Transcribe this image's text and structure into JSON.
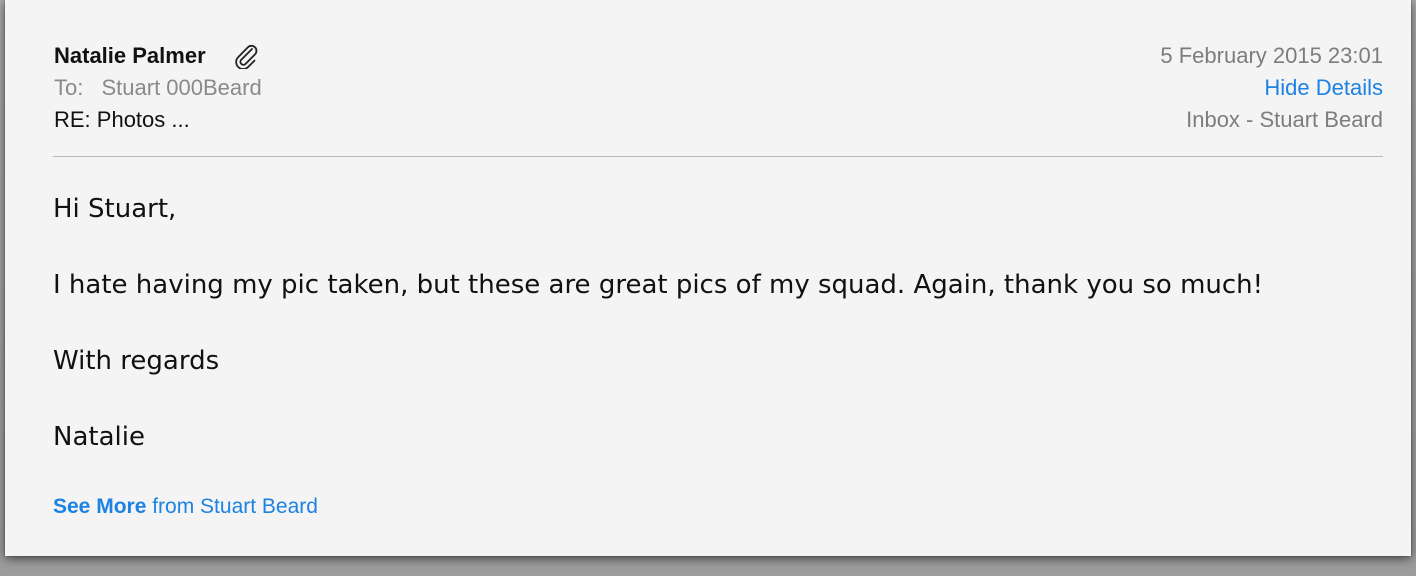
{
  "message": {
    "sender": "Natalie Palmer",
    "to_label": "To:",
    "to_value": "Stuart 000Beard",
    "subject": "RE: Photos ...",
    "date": "5 February 2015 23:01",
    "hide_details": "Hide Details",
    "mailbox": "Inbox - Stuart Beard"
  },
  "body": {
    "greeting": "Hi Stuart,",
    "text": "I hate having my pic taken, but these are great pics of my squad. Again, thank you so much!",
    "closing": "With regards",
    "signature": "Natalie"
  },
  "footer": {
    "see_more": "See More",
    "see_more_suffix": "from Stuart Beard"
  },
  "icons": {
    "attachment": "paperclip-icon"
  },
  "colors": {
    "link": "#1d82e3",
    "muted": "#7d7d7d"
  }
}
